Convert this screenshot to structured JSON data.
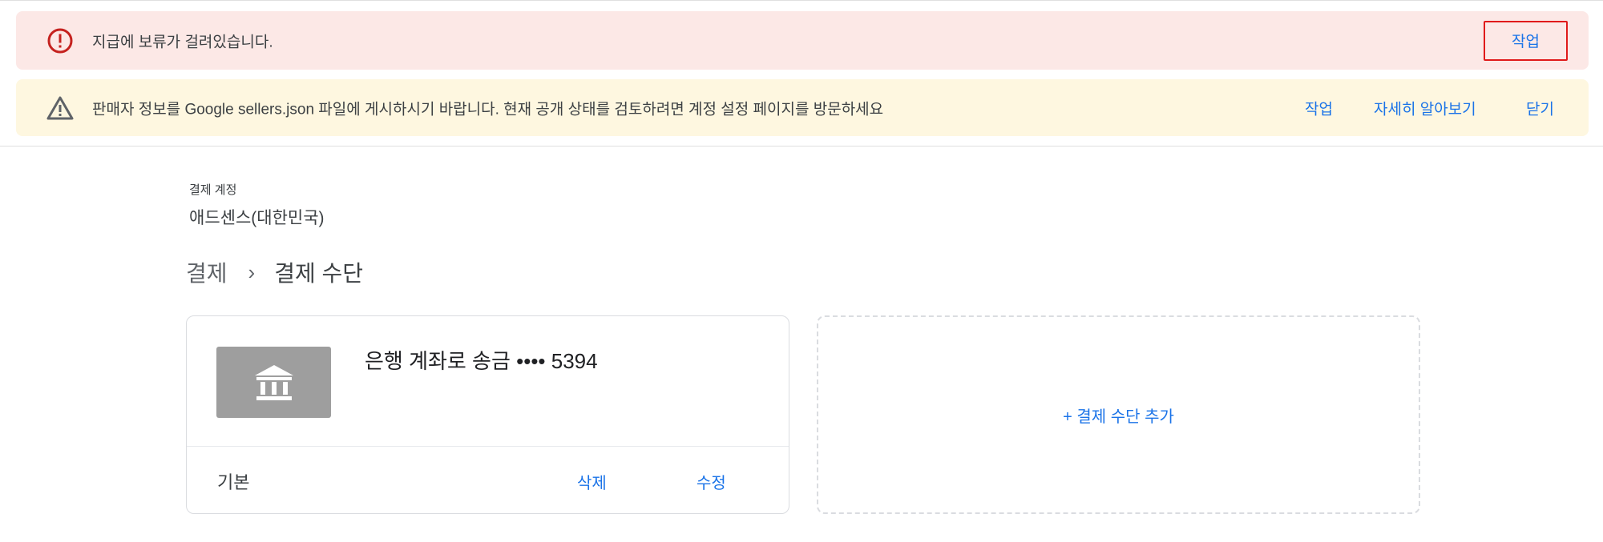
{
  "alerts": {
    "error": {
      "icon": "error-circle-icon",
      "message": "지급에 보류가 걸려있습니다.",
      "action_label": "작업",
      "color": "#c5221f"
    },
    "warning": {
      "icon": "warning-triangle-icon",
      "message": "판매자 정보를 Google sellers.json 파일에 게시하시기 바랍니다. 현재 공개 상태를 검토하려면 계정 설정 페이지를 방문하세요",
      "action_label": "작업",
      "learn_more_label": "자세히 알아보기",
      "dismiss_label": "닫기",
      "color": "#5f6368"
    }
  },
  "account": {
    "label": "결제 계정",
    "name": "애드센스(대한민국)"
  },
  "breadcrumb": {
    "parent": "결제",
    "separator": "›",
    "current": "결제 수단"
  },
  "payment_method": {
    "icon": "bank-icon",
    "title": "은행 계좌로 송금 •••• 5394",
    "status": "기본",
    "delete_label": "삭제",
    "edit_label": "수정"
  },
  "add_method": {
    "label": "+ 결제 수단 추가"
  },
  "colors": {
    "accent": "#1a73e8",
    "error_bg": "#fce8e6",
    "warning_bg": "#fef7e0",
    "highlight_border": "#e01a1a"
  }
}
